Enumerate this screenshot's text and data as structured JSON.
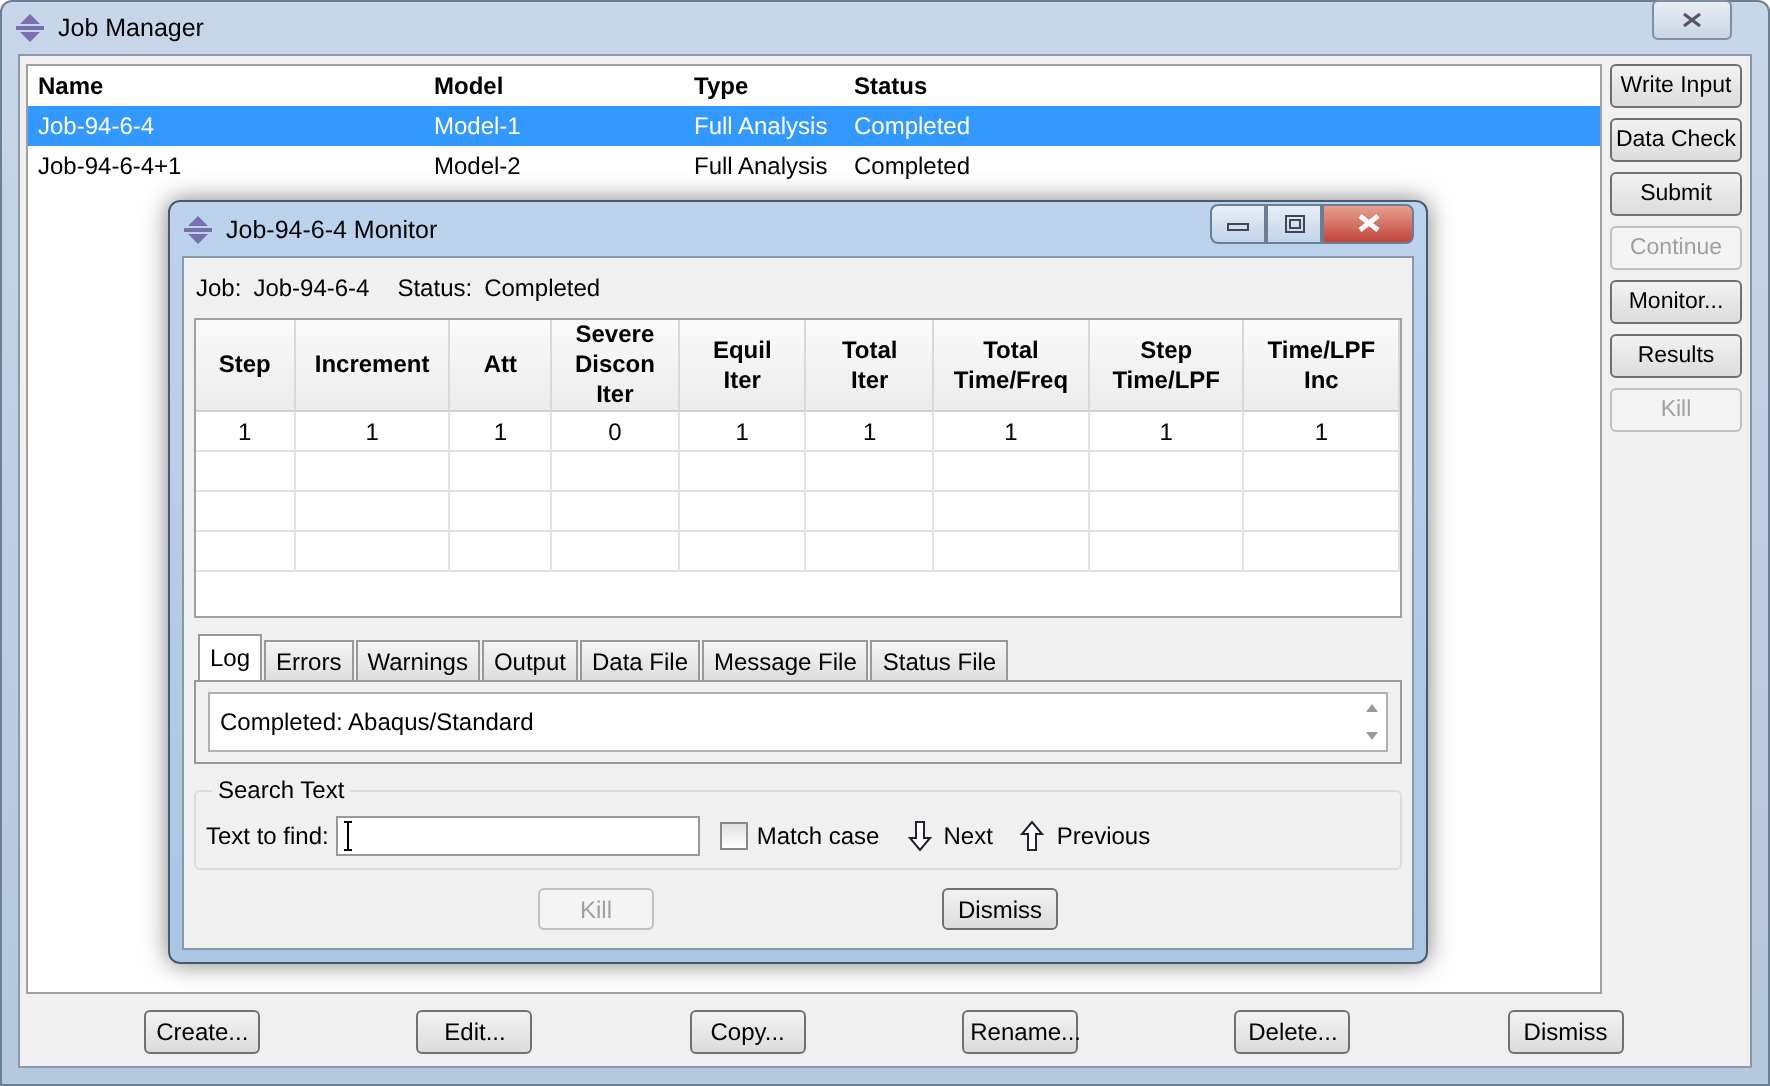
{
  "window": {
    "title": "Job Manager"
  },
  "jobs": {
    "columns": [
      "Name",
      "Model",
      "Type",
      "Status"
    ],
    "rows": [
      {
        "cells": [
          "Job-94-6-4",
          "Model-1",
          "Full Analysis",
          "Completed"
        ],
        "selected": true
      },
      {
        "cells": [
          "Job-94-6-4+1",
          "Model-2",
          "Full Analysis",
          "Completed"
        ],
        "selected": false
      }
    ]
  },
  "side_buttons": [
    {
      "label": "Write Input",
      "disabled": false
    },
    {
      "label": "Data Check",
      "disabled": false
    },
    {
      "label": "Submit",
      "disabled": false
    },
    {
      "label": "Continue",
      "disabled": true
    },
    {
      "label": "Monitor...",
      "disabled": false
    },
    {
      "label": "Results",
      "disabled": false
    },
    {
      "label": "Kill",
      "disabled": true
    }
  ],
  "bottom_buttons": [
    "Create...",
    "Edit...",
    "Copy...",
    "Rename...",
    "Delete...",
    "Dismiss"
  ],
  "monitor": {
    "title": "Job-94-6-4 Monitor",
    "job_label": "Job:",
    "job_value": "Job-94-6-4",
    "status_label": "Status:",
    "status_value": "Completed",
    "table": {
      "columns": [
        "Step",
        "Increment",
        "Att",
        "Severe\nDiscon\nIter",
        "Equil\nIter",
        "Total\nIter",
        "Total\nTime/Freq",
        "Step\nTime/LPF",
        "Time/LPF\nInc"
      ],
      "rows": [
        [
          "1",
          "1",
          "1",
          "0",
          "1",
          "1",
          "1",
          "1",
          "1"
        ]
      ]
    },
    "tabs": [
      {
        "label": "Log",
        "selected": true
      },
      {
        "label": "Errors",
        "selected": false
      },
      {
        "label": "Warnings",
        "selected": false
      },
      {
        "label": "Output",
        "selected": false
      },
      {
        "label": "Data File",
        "selected": false
      },
      {
        "label": "Message File",
        "selected": false
      },
      {
        "label": "Status File",
        "selected": false
      }
    ],
    "log": "Completed: Abaqus/Standard",
    "search": {
      "title": "Search Text",
      "label": "Text to find:",
      "match_case": {
        "label": "Match case",
        "checked": false
      },
      "next": "Next",
      "previous": "Previous"
    },
    "buttons": [
      {
        "label": "Kill",
        "disabled": true
      },
      {
        "label": "Dismiss",
        "disabled": false
      }
    ]
  }
}
